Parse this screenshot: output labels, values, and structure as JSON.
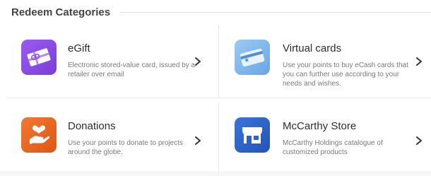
{
  "section": {
    "title": "Redeem Categories"
  },
  "categories": [
    {
      "title": "eGift",
      "description": "Electronic stored-value card, issued by a retailer over email",
      "icon": "gift-card-icon",
      "icon_color": "#8e4fe0"
    },
    {
      "title": "Virtual cards",
      "description": "Use your points to buy eCash cards that you can further use according to your needs and wishes.",
      "icon": "virtual-card-icon",
      "icon_color": "#7eb6ea"
    },
    {
      "title": "Donations",
      "description": "Use your points to donate to projects around the globe.",
      "icon": "heart-hand-icon",
      "icon_color": "#e5641f"
    },
    {
      "title": "McCarthy Store",
      "description": "McCarthy Holdings catalogue of customized products",
      "icon": "storefront-icon",
      "icon_color": "#2b63c8"
    }
  ]
}
